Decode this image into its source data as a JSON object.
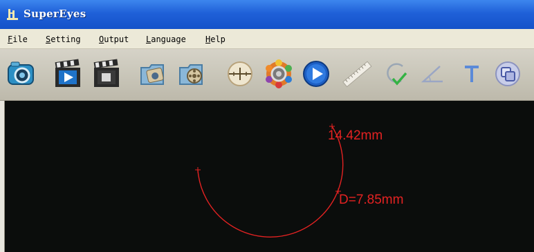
{
  "window": {
    "title": "SuperEyes",
    "icon": "app-logo-icon"
  },
  "menu": [
    {
      "label": "File",
      "accel": "F",
      "rest": "ile"
    },
    {
      "label": "Setting",
      "accel": "S",
      "rest": "etting"
    },
    {
      "label": "Output",
      "accel": "O",
      "rest": "utput"
    },
    {
      "label": "Language",
      "accel": "L",
      "rest": "anguage"
    },
    {
      "label": "Help",
      "accel": "H",
      "rest": "elp"
    }
  ],
  "toolbar": [
    "camera-snapshot-icon",
    "video-record-icon",
    "video-stop-icon",
    "photo-folder-icon",
    "video-folder-icon",
    "crosshair-icon",
    "settings-gear-icon",
    "play-icon",
    "ruler-icon",
    "circle-measure-icon",
    "angle-measure-icon",
    "text-tool-icon",
    "overlay-icon"
  ],
  "measurements": {
    "arc_length": "14.42mm",
    "diameter": "D=7.85mm",
    "color": "#e42222"
  },
  "colors": {
    "titlebar": "#1f60d8",
    "viewport": "#0b0d0c",
    "measure": "#e42222"
  }
}
